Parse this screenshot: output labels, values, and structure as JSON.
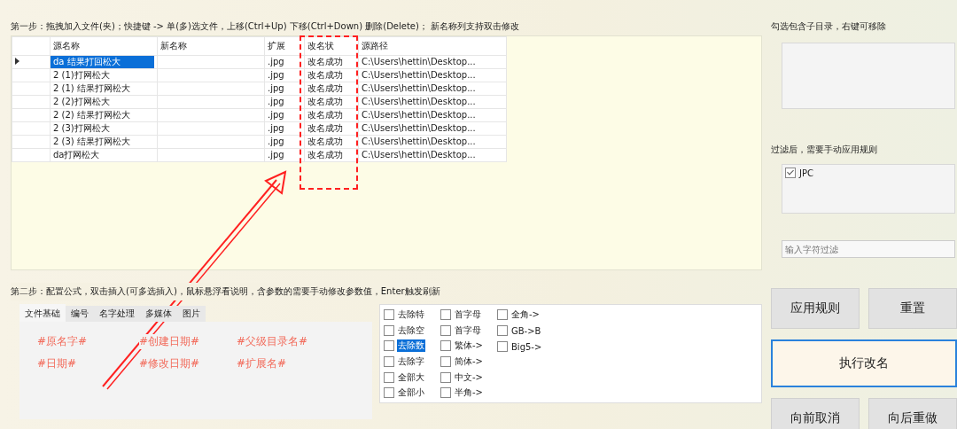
{
  "step1": {
    "label": "第一步：拖拽加入文件(夹)；快捷键 -> 单(多)选文件，上移(Ctrl+Up) 下移(Ctrl+Down) 删除(Delete)； 新名称列支持双击修改"
  },
  "table": {
    "columns": [
      "源名称",
      "新名称",
      "扩展",
      "改名状",
      "源路径"
    ],
    "rows": [
      {
        "selected": true,
        "cells": [
          "da 结果打回松大",
          "",
          ".jpg",
          "改名成功",
          "C:\\Users\\hettin\\Desktop..."
        ]
      },
      {
        "selected": false,
        "cells": [
          "2 (1)打网松大",
          "",
          ".jpg",
          "改名成功",
          "C:\\Users\\hettin\\Desktop..."
        ]
      },
      {
        "selected": false,
        "cells": [
          "2 (1) 结果打网松大",
          "",
          ".jpg",
          "改名成功",
          "C:\\Users\\hettin\\Desktop..."
        ]
      },
      {
        "selected": false,
        "cells": [
          "2 (2)打网松大",
          "",
          ".jpg",
          "改名成功",
          "C:\\Users\\hettin\\Desktop..."
        ]
      },
      {
        "selected": false,
        "cells": [
          "2 (2) 结果打网松大",
          "",
          ".jpg",
          "改名成功",
          "C:\\Users\\hettin\\Desktop..."
        ]
      },
      {
        "selected": false,
        "cells": [
          "2 (3)打网松大",
          "",
          ".jpg",
          "改名成功",
          "C:\\Users\\hettin\\Desktop..."
        ]
      },
      {
        "selected": false,
        "cells": [
          "2 (3) 结果打网松大",
          "",
          ".jpg",
          "改名成功",
          "C:\\Users\\hettin\\Desktop..."
        ]
      },
      {
        "selected": false,
        "cells": [
          "da打网松大",
          "",
          ".jpg",
          "改名成功",
          "C:\\Users\\hettin\\Desktop..."
        ]
      }
    ]
  },
  "step2": {
    "label": "第二步：配置公式，双击插入(可多选插入)，鼠标悬浮看说明，含参数的需要手动修改参数值，Enter触发刷新"
  },
  "tabs": [
    {
      "label": "文件基础",
      "selected": true
    },
    {
      "label": "编号",
      "selected": false
    },
    {
      "label": "名字处理",
      "selected": false
    },
    {
      "label": "多媒体",
      "selected": false
    },
    {
      "label": "图片",
      "selected": false
    }
  ],
  "tokens": [
    "#原名字#",
    "#创建日期#",
    "#父级目录名#",
    "#日期#",
    "#修改日期#",
    "#扩展名#"
  ],
  "options": [
    [
      {
        "label": "去除特",
        "checked": false,
        "selected": false
      },
      {
        "label": "去除空",
        "checked": false,
        "selected": false
      },
      {
        "label": "去除数",
        "checked": false,
        "selected": true
      },
      {
        "label": "去除字",
        "checked": false,
        "selected": false
      },
      {
        "label": "全部大",
        "checked": false,
        "selected": false
      },
      {
        "label": "全部小",
        "checked": false,
        "selected": false
      }
    ],
    [
      {
        "label": "首字母",
        "checked": false,
        "selected": false
      },
      {
        "label": "首字母",
        "checked": false,
        "selected": false
      },
      {
        "label": "繁体->",
        "checked": false,
        "selected": false
      },
      {
        "label": "简体->",
        "checked": false,
        "selected": false
      },
      {
        "label": "中文->",
        "checked": false,
        "selected": false
      },
      {
        "label": "半角->",
        "checked": false,
        "selected": false
      }
    ],
    [
      {
        "label": "全角->",
        "checked": false,
        "selected": false
      },
      {
        "label": "GB->B",
        "checked": false,
        "selected": false
      },
      {
        "label": "Big5->",
        "checked": false,
        "selected": false
      }
    ]
  ],
  "sidebar": {
    "dir_label": "勾选包含子目录，右键可移除",
    "filter_label": "过滤后，需要手动应用规则",
    "filters": [
      {
        "label": "JPC",
        "checked": true
      }
    ],
    "filter_input": {
      "placeholder": "输入字符过滤"
    },
    "buttons": [
      {
        "label": "应用规则",
        "kind": "small",
        "focused": false
      },
      {
        "label": "重置",
        "kind": "small",
        "focused": false
      },
      {
        "label": "执行改名",
        "kind": "wide",
        "focused": true
      },
      {
        "label": "向前取消",
        "kind": "small",
        "focused": false
      },
      {
        "label": "向后重做",
        "kind": "small",
        "focused": false
      }
    ]
  }
}
